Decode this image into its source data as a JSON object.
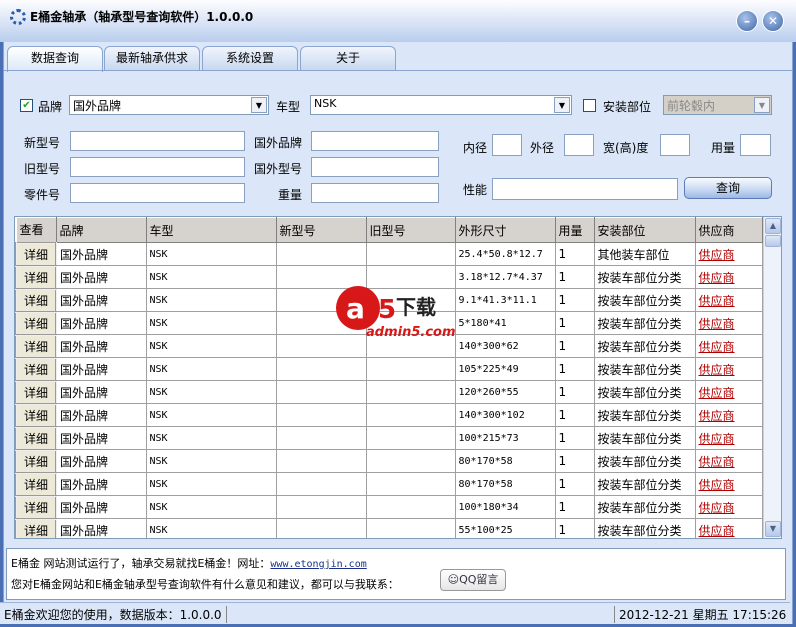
{
  "window": {
    "title": "E桶金轴承（轴承型号查询软件）1.0.0.0",
    "minimize": "–",
    "close": "✕"
  },
  "tabs": [
    {
      "label": "数据查询"
    },
    {
      "label": "最新轴承供求"
    },
    {
      "label": "系统设置"
    },
    {
      "label": "关于"
    }
  ],
  "filters": {
    "brand_label": "品牌",
    "brand_checked": true,
    "brand_value": "国外品牌",
    "model_label": "车型",
    "model_value": "NSK",
    "install_label": "安装部位",
    "install_checked": false,
    "install_value": "前轮毂内",
    "new_no_label": "新型号",
    "new_no_value": "",
    "foreign_brand_label": "国外品牌",
    "foreign_brand_value": "",
    "inner_label": "内径",
    "outer_label": "外径",
    "width_label": "宽(高)度",
    "qty_label": "用量",
    "old_no_label": "旧型号",
    "old_no_value": "",
    "foreign_model_label": "国外型号",
    "foreign_model_value": "",
    "part_no_label": "零件号",
    "weight_label": "重量",
    "perf_label": "性能",
    "query_button": "查询"
  },
  "table": {
    "columns": [
      "查看",
      "品牌",
      "车型",
      "新型号",
      "旧型号",
      "外形尺寸",
      "用量",
      "安装部位",
      "供应商"
    ],
    "rows": [
      [
        "详细",
        "国外品牌",
        "NSK",
        "",
        "",
        "25.4*50.8*12.7",
        "1",
        "其他装车部位",
        "供应商"
      ],
      [
        "详细",
        "国外品牌",
        "NSK",
        "",
        "",
        "3.18*12.7*4.37",
        "1",
        "按装车部位分类",
        "供应商"
      ],
      [
        "详细",
        "国外品牌",
        "NSK",
        "",
        "",
        "9.1*41.3*11.1",
        "1",
        "按装车部位分类",
        "供应商"
      ],
      [
        "详细",
        "国外品牌",
        "NSK",
        "",
        "",
        "5*180*41",
        "1",
        "按装车部位分类",
        "供应商"
      ],
      [
        "详细",
        "国外品牌",
        "NSK",
        "",
        "",
        "140*300*62",
        "1",
        "按装车部位分类",
        "供应商"
      ],
      [
        "详细",
        "国外品牌",
        "NSK",
        "",
        "",
        "105*225*49",
        "1",
        "按装车部位分类",
        "供应商"
      ],
      [
        "详细",
        "国外品牌",
        "NSK",
        "",
        "",
        "120*260*55",
        "1",
        "按装车部位分类",
        "供应商"
      ],
      [
        "详细",
        "国外品牌",
        "NSK",
        "",
        "",
        "140*300*102",
        "1",
        "按装车部位分类",
        "供应商"
      ],
      [
        "详细",
        "国外品牌",
        "NSK",
        "",
        "",
        "100*215*73",
        "1",
        "按装车部位分类",
        "供应商"
      ],
      [
        "详细",
        "国外品牌",
        "NSK",
        "",
        "",
        "80*170*58",
        "1",
        "按装车部位分类",
        "供应商"
      ],
      [
        "详细",
        "国外品牌",
        "NSK",
        "",
        "",
        "80*170*58",
        "1",
        "按装车部位分类",
        "供应商"
      ],
      [
        "详细",
        "国外品牌",
        "NSK",
        "",
        "",
        "100*180*34",
        "1",
        "按装车部位分类",
        "供应商"
      ],
      [
        "详细",
        "国外品牌",
        "NSK",
        "",
        "",
        "55*100*25",
        "1",
        "按装车部位分类",
        "供应商"
      ]
    ]
  },
  "message": {
    "line1_text": "E桶金 网站测试运行了，轴承交易就找E桶金！网址：",
    "line1_link": "www.etongjin.com",
    "line2_text": "您对E桶金网站和E桶金轴承型号查询软件有什么意见和建议，都可以与我联系：",
    "qq_button": "QQ留言"
  },
  "watermark": {
    "brand": "a5下载",
    "url": "admin5.com"
  },
  "status": {
    "left": "E桶金欢迎您的使用，数据版本：1.0.0.0",
    "date": "2012-12-21",
    "weekday": "星期五",
    "time": "17:15:26"
  }
}
